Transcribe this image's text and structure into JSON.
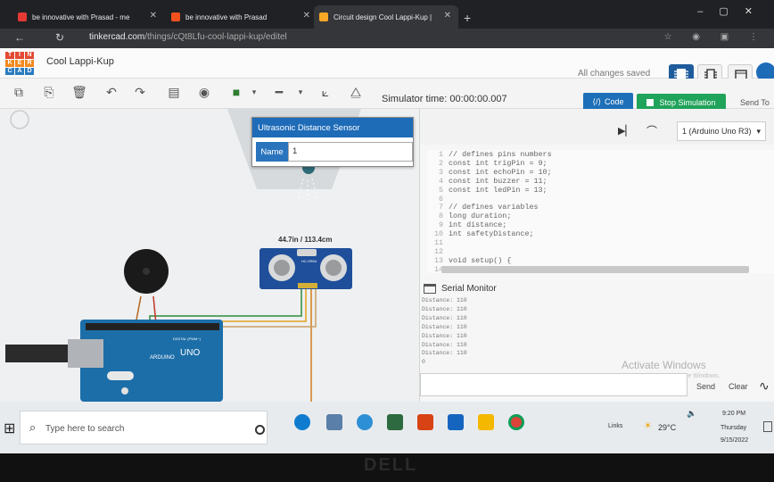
{
  "browser": {
    "tabs": [
      {
        "title": "be innovative with Prasad - me",
        "icon_color": "#e53935"
      },
      {
        "title": "be innovative with Prasad",
        "icon_color": "#f4511e"
      },
      {
        "title": "Circuit design Cool Lappi-Kup |",
        "icon_color": "#f9a825"
      }
    ],
    "url_host": "tinkercad.com",
    "url_path": "/things/cQt8Lfu-cool-lappi-kup/editel"
  },
  "app": {
    "project_title": "Cool Lappi-Kup",
    "save_status": "All changes saved",
    "logo_letters": [
      "T",
      "I",
      "N",
      "K",
      "E",
      "R",
      "C",
      "A",
      "D"
    ],
    "logo_colors": [
      "#e24a33",
      "#e24a33",
      "#e24a33",
      "#f28a1e",
      "#f28a1e",
      "#f28a1e",
      "#2b7bbf",
      "#2b7bbf",
      "#2b7bbf"
    ]
  },
  "toolbar": {
    "sim_time": "Simulator time: 00:00:00.007",
    "code_label": "Code",
    "stop_label": "Stop Simulation",
    "send_to_label": "Send To"
  },
  "sensor_popup": {
    "title": "Ultrasonic Distance Sensor",
    "name_label": "Name",
    "name_value": "1"
  },
  "canvas": {
    "distance_readout": "44.7in / 113.4cm",
    "sensor_label": "HC-SR04",
    "arduino_brand": "ARDUINO",
    "arduino_model": "UNO",
    "digital_label": "DIGITAL (PWM~)"
  },
  "code_panel": {
    "board": "1 (Arduino Uno R3)",
    "lines": [
      {
        "n": "1",
        "text": "// defines pins numbers"
      },
      {
        "n": "2",
        "text": "const int trigPin = 9;"
      },
      {
        "n": "3",
        "text": "const int echoPin = 10;"
      },
      {
        "n": "4",
        "text": "const int buzzer = 11;"
      },
      {
        "n": "5",
        "text": "const int ledPin = 13;"
      },
      {
        "n": "6",
        "text": ""
      },
      {
        "n": "7",
        "text": "// defines variables"
      },
      {
        "n": "8",
        "text": "long duration;"
      },
      {
        "n": "9",
        "text": "int distance;"
      },
      {
        "n": "10",
        "text": "int safetyDistance;"
      },
      {
        "n": "11",
        "text": ""
      },
      {
        "n": "12",
        "text": ""
      },
      {
        "n": "13",
        "text": "void setup() {"
      },
      {
        "n": "14",
        "text": ""
      }
    ]
  },
  "serial": {
    "title": "Serial Monitor",
    "lines": [
      "Distance: 110",
      "Distance: 110",
      "Distance: 110",
      "Distance: 110",
      "Distance: 110",
      "Distance: 110",
      "Distance: 110",
      "0"
    ],
    "send_label": "Send",
    "clear_label": "Clear",
    "watermark_title": "Activate Windows",
    "watermark_sub": "Go to Settings to activate Windows."
  },
  "taskbar": {
    "search_placeholder": "Type here to search",
    "links": "Links",
    "weather": "29°C",
    "time": "9:20 PM",
    "day": "Thursday",
    "date": "9/15/2022"
  },
  "hardware": {
    "brand": "DELL"
  }
}
